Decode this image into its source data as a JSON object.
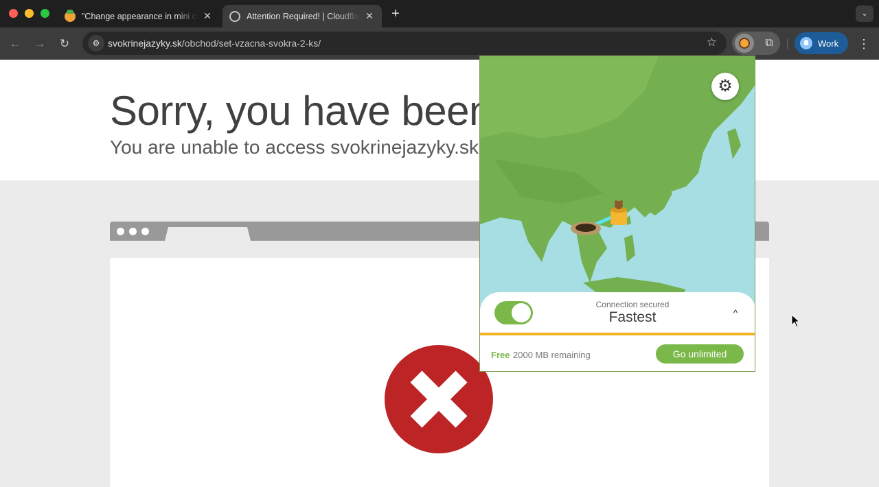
{
  "browser": {
    "tabs": [
      {
        "title": "\"Change appearance in mini control\"",
        "favicon": "tunnelbear-icon",
        "close": "✕"
      },
      {
        "title": "Attention Required! | Cloudflare",
        "favicon": "globe-icon",
        "close": "✕"
      }
    ],
    "new_tab": "+",
    "tab_search": "⌄",
    "address": {
      "domain": "svokrinejazyky.sk",
      "path": "/obchod/set-vzacna-svokra-2-ks/"
    },
    "profile_label": "Work"
  },
  "page": {
    "headline": "Sorry, you have been b",
    "subheadline": "You are unable to access svokrinejazyky.sk"
  },
  "popup": {
    "connection_status": "Connection secured",
    "location": "Fastest",
    "plan_label": "Free",
    "data_remaining": "2000 MB remaining",
    "upgrade_button": "Go unlimited",
    "vpn_enabled": true,
    "accent_green": "#7ab84a",
    "accent_yellow": "#f0b323"
  }
}
